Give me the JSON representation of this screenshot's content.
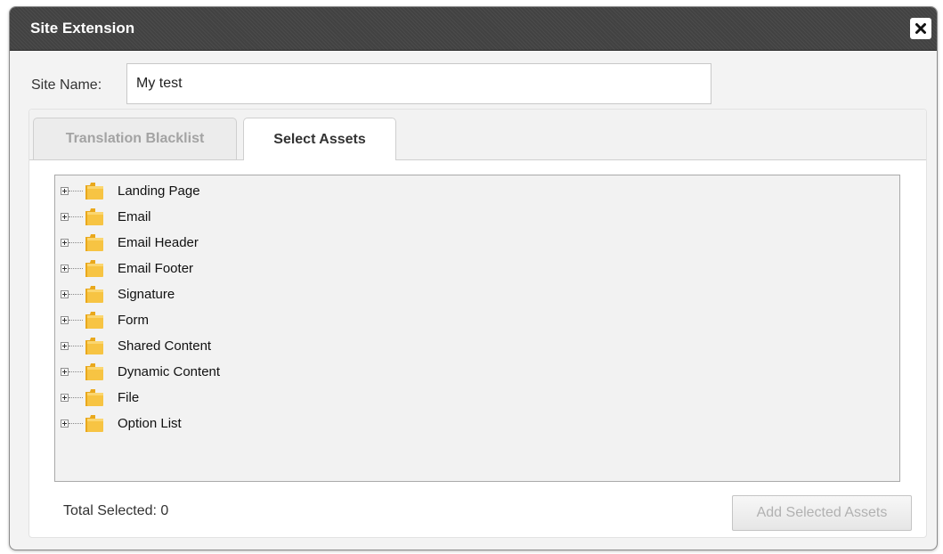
{
  "dialog": {
    "title": "Site Extension",
    "close_icon": "close-icon"
  },
  "site_name": {
    "label": "Site Name:",
    "value": "My test"
  },
  "tabs": [
    {
      "label": "Translation Blacklist",
      "active": false
    },
    {
      "label": "Select Assets",
      "active": true
    }
  ],
  "tree": {
    "items": [
      {
        "label": "Landing Page",
        "icon": "folder-icon"
      },
      {
        "label": "Email",
        "icon": "folder-icon"
      },
      {
        "label": "Email Header",
        "icon": "folder-icon"
      },
      {
        "label": "Email Footer",
        "icon": "folder-icon"
      },
      {
        "label": "Signature",
        "icon": "folder-icon"
      },
      {
        "label": "Form",
        "icon": "folder-icon"
      },
      {
        "label": "Shared Content",
        "icon": "folder-icon"
      },
      {
        "label": "Dynamic Content",
        "icon": "folder-icon"
      },
      {
        "label": "File",
        "icon": "folder-icon"
      },
      {
        "label": "Option List",
        "icon": "folder-icon"
      }
    ]
  },
  "footer": {
    "total_selected": "Total Selected: 0",
    "add_button_label": "Add Selected Assets",
    "add_button_disabled": true
  },
  "colors": {
    "titlebar": "#424242",
    "folder": "#f0b429",
    "disabled_text": "#b1b1b1"
  }
}
